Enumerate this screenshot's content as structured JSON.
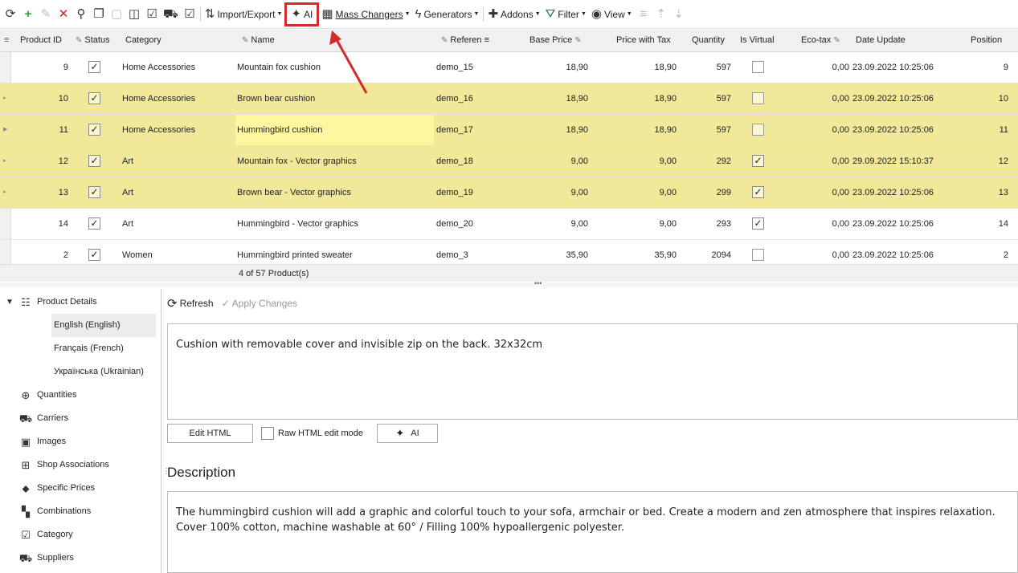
{
  "toolbar": {
    "import_export": "Import/Export",
    "ai": "AI",
    "mass_changers": "Mass Changers",
    "generators": "Generators",
    "addons": "Addons",
    "filter": "Filter",
    "view": "View"
  },
  "grid": {
    "headers": {
      "product_id": "Product ID",
      "status": "Status",
      "category": "Category",
      "name": "Name",
      "reference": "Referen",
      "base_price": "Base Price",
      "price_tax": "Price with Tax",
      "quantity": "Quantity",
      "is_virtual": "Is Virtual",
      "eco_tax": "Eco-tax",
      "date_update": "Date Update",
      "position": "Position"
    },
    "rows": [
      {
        "id": "9",
        "category": "Home Accessories",
        "name": "Mountain fox cushion",
        "ref": "demo_15",
        "base": "18,90",
        "tax": "18,90",
        "qty": "597",
        "virtual": false,
        "eco": "0,00",
        "date": "23.09.2022 10:25:06",
        "pos": "9",
        "selected": false
      },
      {
        "id": "10",
        "category": "Home Accessories",
        "name": "Brown bear cushion",
        "ref": "demo_16",
        "base": "18,90",
        "tax": "18,90",
        "qty": "597",
        "virtual": false,
        "eco": "0,00",
        "date": "23.09.2022 10:25:06",
        "pos": "10",
        "selected": true
      },
      {
        "id": "11",
        "category": "Home Accessories",
        "name": "Hummingbird cushion",
        "ref": "demo_17",
        "base": "18,90",
        "tax": "18,90",
        "qty": "597",
        "virtual": false,
        "eco": "0,00",
        "date": "23.09.2022 10:25:06",
        "pos": "11",
        "selected": true
      },
      {
        "id": "12",
        "category": "Art",
        "name": "Mountain fox - Vector graphics",
        "ref": "demo_18",
        "base": "9,00",
        "tax": "9,00",
        "qty": "292",
        "virtual": true,
        "eco": "0,00",
        "date": "29.09.2022 15:10:37",
        "pos": "12",
        "selected": true
      },
      {
        "id": "13",
        "category": "Art",
        "name": "Brown bear - Vector graphics",
        "ref": "demo_19",
        "base": "9,00",
        "tax": "9,00",
        "qty": "299",
        "virtual": true,
        "eco": "0,00",
        "date": "23.09.2022 10:25:06",
        "pos": "13",
        "selected": true
      },
      {
        "id": "14",
        "category": "Art",
        "name": "Hummingbird - Vector graphics",
        "ref": "demo_20",
        "base": "9,00",
        "tax": "9,00",
        "qty": "293",
        "virtual": true,
        "eco": "0,00",
        "date": "23.09.2022 10:25:06",
        "pos": "14",
        "selected": false
      },
      {
        "id": "2",
        "category": "Women",
        "name": "Hummingbird printed sweater",
        "ref": "demo_3",
        "base": "35,90",
        "tax": "35,90",
        "qty": "2094",
        "virtual": false,
        "eco": "0,00",
        "date": "23.09.2022 10:25:06",
        "pos": "2",
        "selected": false
      }
    ],
    "status_text": "4 of 57 Product(s)"
  },
  "tree": {
    "product_details": "Product Details",
    "languages": [
      "English (English)",
      "Français (French)",
      "Українська (Ukrainian)"
    ],
    "items": [
      "Quantities",
      "Carriers",
      "Images",
      "Shop Associations",
      "Specific Prices",
      "Combinations",
      "Category",
      "Suppliers"
    ]
  },
  "detail": {
    "refresh": "Refresh",
    "apply": "Apply Changes",
    "short_text": "Cushion with removable cover and invisible zip on the back. 32x32cm",
    "edit_html": "Edit HTML",
    "raw_mode": "Raw HTML edit mode",
    "ai": "AI",
    "desc_title": "Description",
    "desc_text": "The hummingbird cushion will add a graphic and colorful touch to your sofa, armchair or bed. Create a modern and zen atmosphere that inspires relaxation. Cover 100% cotton, machine washable at 60° / Filling 100% hypoallergenic polyester."
  },
  "colors": {
    "selected_row": "#f1e899",
    "highlight": "#d32a2a"
  }
}
